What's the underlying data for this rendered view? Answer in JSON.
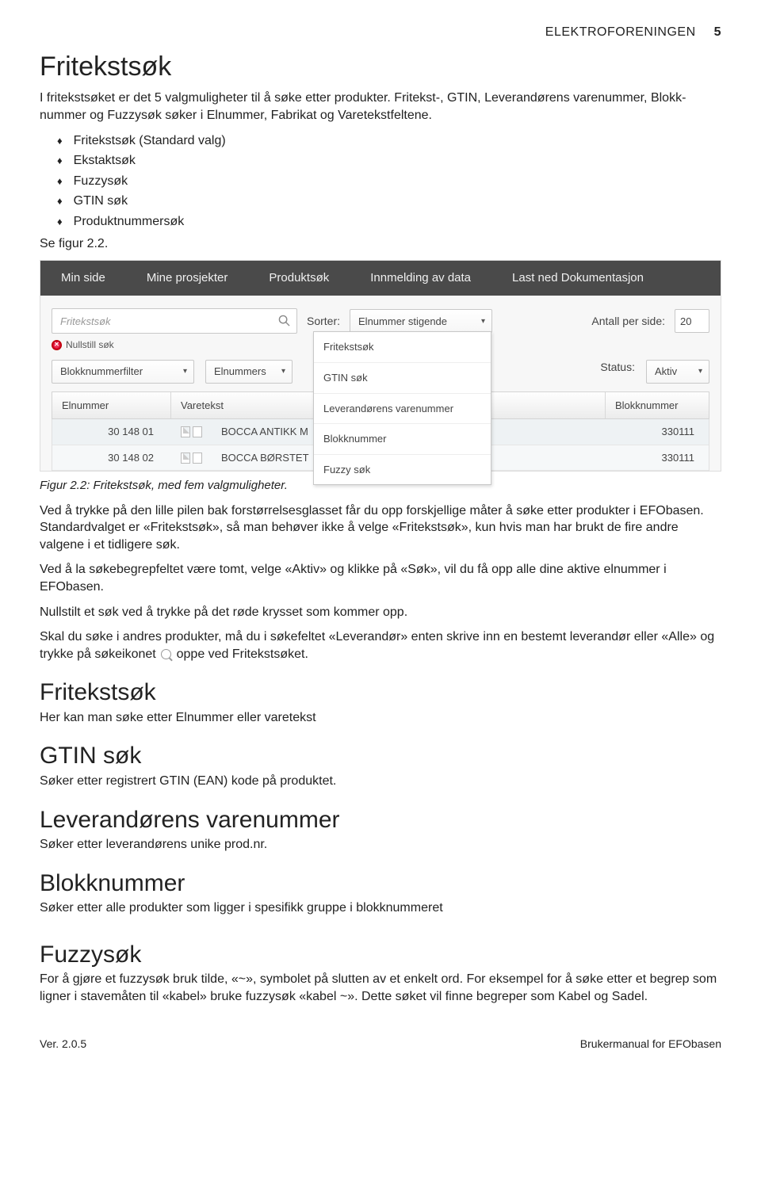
{
  "header": {
    "org": "ELEKTROFORENINGEN",
    "page": "5"
  },
  "h1": "Fritekstsøk",
  "intro": "I fritekstsøket er det 5 valgmuligheter til å søke etter produkter. Fritekst-, GTIN, Leverandørens varenummer, Blokk­nummer og Fuzzysøk søker i Elnummer, Fabrikat og Varetekstfeltene.",
  "bullets": [
    "Fritekstsøk (Standard valg)",
    "Ekstaktsøk",
    "Fuzzysøk",
    "GTIN søk",
    "Produktnummersøk"
  ],
  "seefig": "Se figur 2.2.",
  "shot": {
    "nav": [
      "Min side",
      "Mine prosjekter",
      "Produktsøk",
      "Innmelding av data",
      "Last ned Dokumentasjon"
    ],
    "search_placeholder": "Fritekstsøk",
    "reset": "Nullstill søk",
    "sorter_label": "Sorter:",
    "sorter_value": "Elnummer stigende",
    "perpage_label": "Antall per side:",
    "perpage_value": "20",
    "dropdown": [
      "Fritekstsøk",
      "GTIN søk",
      "Leverandørens varenummer",
      "Blokknummer",
      "Fuzzy søk"
    ],
    "filter_block": "Blokknummerfilter",
    "filter_eln": "Elnummers",
    "status_label": "Status:",
    "status_value": "Aktiv",
    "cols": {
      "el": "Elnummer",
      "vt": "Varetekst",
      "bl": "Blokknummer"
    },
    "rows": [
      {
        "el": "30 148 01",
        "vt": "BOCCA ANTIKK M",
        "bl": "330111"
      },
      {
        "el": "30 148 02",
        "vt": "BOCCA BØRSTET",
        "bl": "330111"
      }
    ]
  },
  "caption": "Figur 2.2: Fritekstsøk, med fem valgmuligheter.",
  "p1": "Ved å trykke på den lille pilen bak forstørrelsesglasset får du opp forskjellige måter å søke etter produkter i EFObasen. Standardvalget er «Fritekstsøk», så man behøver ikke å velge «Fritekstsøk», kun hvis man har brukt de fire andre valgene i et tidligere søk.",
  "p2": "Ved å la søkebegrepfeltet være tomt, velge «Aktiv» og klikke på «Søk», vil du få opp alle dine aktive elnummer i EFObasen.",
  "p3": "Nullstilt et søk ved å trykke på det røde krysset som kommer opp.",
  "p4a": "Skal du søke i andres produkter, må du i søkefeltet «Leverandør» enten skrive inn en bestemt leverandør eller «Alle» og trykke på søkeikonet ",
  "p4b": " oppe ved Fritekstsøket.",
  "sec_fritekst": {
    "h": "Fritekstsøk",
    "t": "Her kan man søke etter Elnummer eller varetekst"
  },
  "sec_gtin": {
    "h": "GTIN søk",
    "t": "Søker etter registrert GTIN (EAN) kode på produktet."
  },
  "sec_lev": {
    "h": "Leverandørens varenummer",
    "t": "Søker etter leverandørens unike prod.nr."
  },
  "sec_blokk": {
    "h": "Blokknummer",
    "t": "Søker etter alle produkter som ligger i spesifikk gruppe i blokknummeret"
  },
  "sec_fuzzy": {
    "h": "Fuzzysøk",
    "t": "For å gjøre et fuzzysøk bruk tilde, «~», symbolet på slutten av et enkelt ord. For eksempel for å søke etter et begrep som ligner i stavemåten til «kabel» bruke fuzzysøk «kabel ~». Dette søket vil finne begreper som Kabel og Sadel."
  },
  "footer": {
    "ver": "Ver. 2.0.5",
    "doc": "Brukermanual for EFObasen"
  }
}
